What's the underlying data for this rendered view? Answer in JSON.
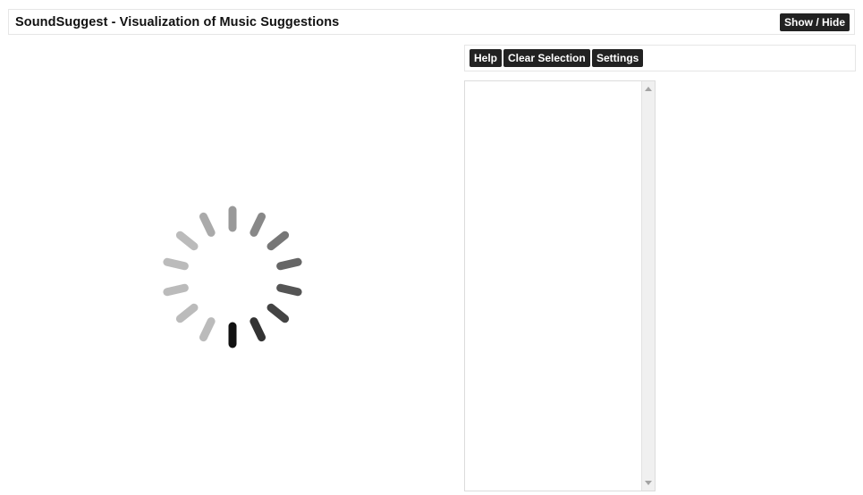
{
  "header": {
    "title": "SoundSuggest - Visualization of Music Suggestions",
    "show_hide_label": "Show / Hide"
  },
  "toolbar": {
    "help_label": "Help",
    "clear_selection_label": "Clear Selection",
    "settings_label": "Settings"
  },
  "spinner": {
    "state": "loading",
    "segment_colors": [
      "#111111",
      "#333333",
      "#444444",
      "#555555",
      "#666666",
      "#777777",
      "#888888",
      "#999999",
      "#aaaaaa",
      "#bbbbbb",
      "#bbbbbb",
      "#bbbbbb",
      "#bbbbbb",
      "#bbbbbb"
    ]
  },
  "colors": {
    "button_bg": "#222222",
    "button_text": "#ffffff",
    "border": "#e6e6e6"
  }
}
